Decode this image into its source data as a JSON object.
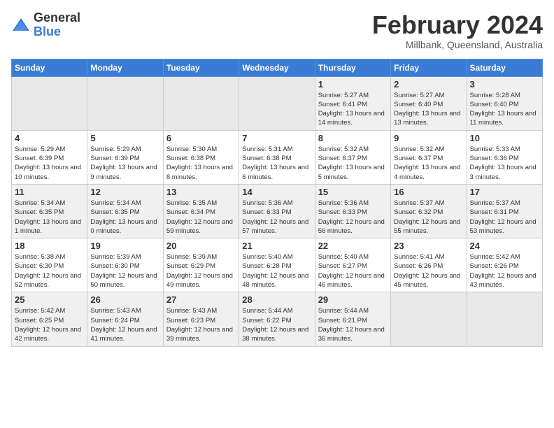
{
  "header": {
    "logo_general": "General",
    "logo_blue": "Blue",
    "month_title": "February 2024",
    "location": "Millbank, Queensland, Australia"
  },
  "days_of_week": [
    "Sunday",
    "Monday",
    "Tuesday",
    "Wednesday",
    "Thursday",
    "Friday",
    "Saturday"
  ],
  "weeks": [
    [
      {
        "day": "",
        "info": ""
      },
      {
        "day": "",
        "info": ""
      },
      {
        "day": "",
        "info": ""
      },
      {
        "day": "",
        "info": ""
      },
      {
        "day": "1",
        "info": "Sunrise: 5:27 AM\nSunset: 6:41 PM\nDaylight: 13 hours\nand 14 minutes."
      },
      {
        "day": "2",
        "info": "Sunrise: 5:27 AM\nSunset: 6:40 PM\nDaylight: 13 hours\nand 13 minutes."
      },
      {
        "day": "3",
        "info": "Sunrise: 5:28 AM\nSunset: 6:40 PM\nDaylight: 13 hours\nand 11 minutes."
      }
    ],
    [
      {
        "day": "4",
        "info": "Sunrise: 5:29 AM\nSunset: 6:39 PM\nDaylight: 13 hours\nand 10 minutes."
      },
      {
        "day": "5",
        "info": "Sunrise: 5:29 AM\nSunset: 6:39 PM\nDaylight: 13 hours\nand 9 minutes."
      },
      {
        "day": "6",
        "info": "Sunrise: 5:30 AM\nSunset: 6:38 PM\nDaylight: 13 hours\nand 8 minutes."
      },
      {
        "day": "7",
        "info": "Sunrise: 5:31 AM\nSunset: 6:38 PM\nDaylight: 13 hours\nand 6 minutes."
      },
      {
        "day": "8",
        "info": "Sunrise: 5:32 AM\nSunset: 6:37 PM\nDaylight: 13 hours\nand 5 minutes."
      },
      {
        "day": "9",
        "info": "Sunrise: 5:32 AM\nSunset: 6:37 PM\nDaylight: 13 hours\nand 4 minutes."
      },
      {
        "day": "10",
        "info": "Sunrise: 5:33 AM\nSunset: 6:36 PM\nDaylight: 13 hours\nand 3 minutes."
      }
    ],
    [
      {
        "day": "11",
        "info": "Sunrise: 5:34 AM\nSunset: 6:35 PM\nDaylight: 13 hours\nand 1 minute."
      },
      {
        "day": "12",
        "info": "Sunrise: 5:34 AM\nSunset: 6:35 PM\nDaylight: 13 hours\nand 0 minutes."
      },
      {
        "day": "13",
        "info": "Sunrise: 5:35 AM\nSunset: 6:34 PM\nDaylight: 12 hours\nand 59 minutes."
      },
      {
        "day": "14",
        "info": "Sunrise: 5:36 AM\nSunset: 6:33 PM\nDaylight: 12 hours\nand 57 minutes."
      },
      {
        "day": "15",
        "info": "Sunrise: 5:36 AM\nSunset: 6:33 PM\nDaylight: 12 hours\nand 56 minutes."
      },
      {
        "day": "16",
        "info": "Sunrise: 5:37 AM\nSunset: 6:32 PM\nDaylight: 12 hours\nand 55 minutes."
      },
      {
        "day": "17",
        "info": "Sunrise: 5:37 AM\nSunset: 6:31 PM\nDaylight: 12 hours\nand 53 minutes."
      }
    ],
    [
      {
        "day": "18",
        "info": "Sunrise: 5:38 AM\nSunset: 6:30 PM\nDaylight: 12 hours\nand 52 minutes."
      },
      {
        "day": "19",
        "info": "Sunrise: 5:39 AM\nSunset: 6:30 PM\nDaylight: 12 hours\nand 50 minutes."
      },
      {
        "day": "20",
        "info": "Sunrise: 5:39 AM\nSunset: 6:29 PM\nDaylight: 12 hours\nand 49 minutes."
      },
      {
        "day": "21",
        "info": "Sunrise: 5:40 AM\nSunset: 6:28 PM\nDaylight: 12 hours\nand 48 minutes."
      },
      {
        "day": "22",
        "info": "Sunrise: 5:40 AM\nSunset: 6:27 PM\nDaylight: 12 hours\nand 46 minutes."
      },
      {
        "day": "23",
        "info": "Sunrise: 5:41 AM\nSunset: 6:26 PM\nDaylight: 12 hours\nand 45 minutes."
      },
      {
        "day": "24",
        "info": "Sunrise: 5:42 AM\nSunset: 6:26 PM\nDaylight: 12 hours\nand 43 minutes."
      }
    ],
    [
      {
        "day": "25",
        "info": "Sunrise: 5:42 AM\nSunset: 6:25 PM\nDaylight: 12 hours\nand 42 minutes."
      },
      {
        "day": "26",
        "info": "Sunrise: 5:43 AM\nSunset: 6:24 PM\nDaylight: 12 hours\nand 41 minutes."
      },
      {
        "day": "27",
        "info": "Sunrise: 5:43 AM\nSunset: 6:23 PM\nDaylight: 12 hours\nand 39 minutes."
      },
      {
        "day": "28",
        "info": "Sunrise: 5:44 AM\nSunset: 6:22 PM\nDaylight: 12 hours\nand 38 minutes."
      },
      {
        "day": "29",
        "info": "Sunrise: 5:44 AM\nSunset: 6:21 PM\nDaylight: 12 hours\nand 36 minutes."
      },
      {
        "day": "",
        "info": ""
      },
      {
        "day": "",
        "info": ""
      }
    ]
  ]
}
